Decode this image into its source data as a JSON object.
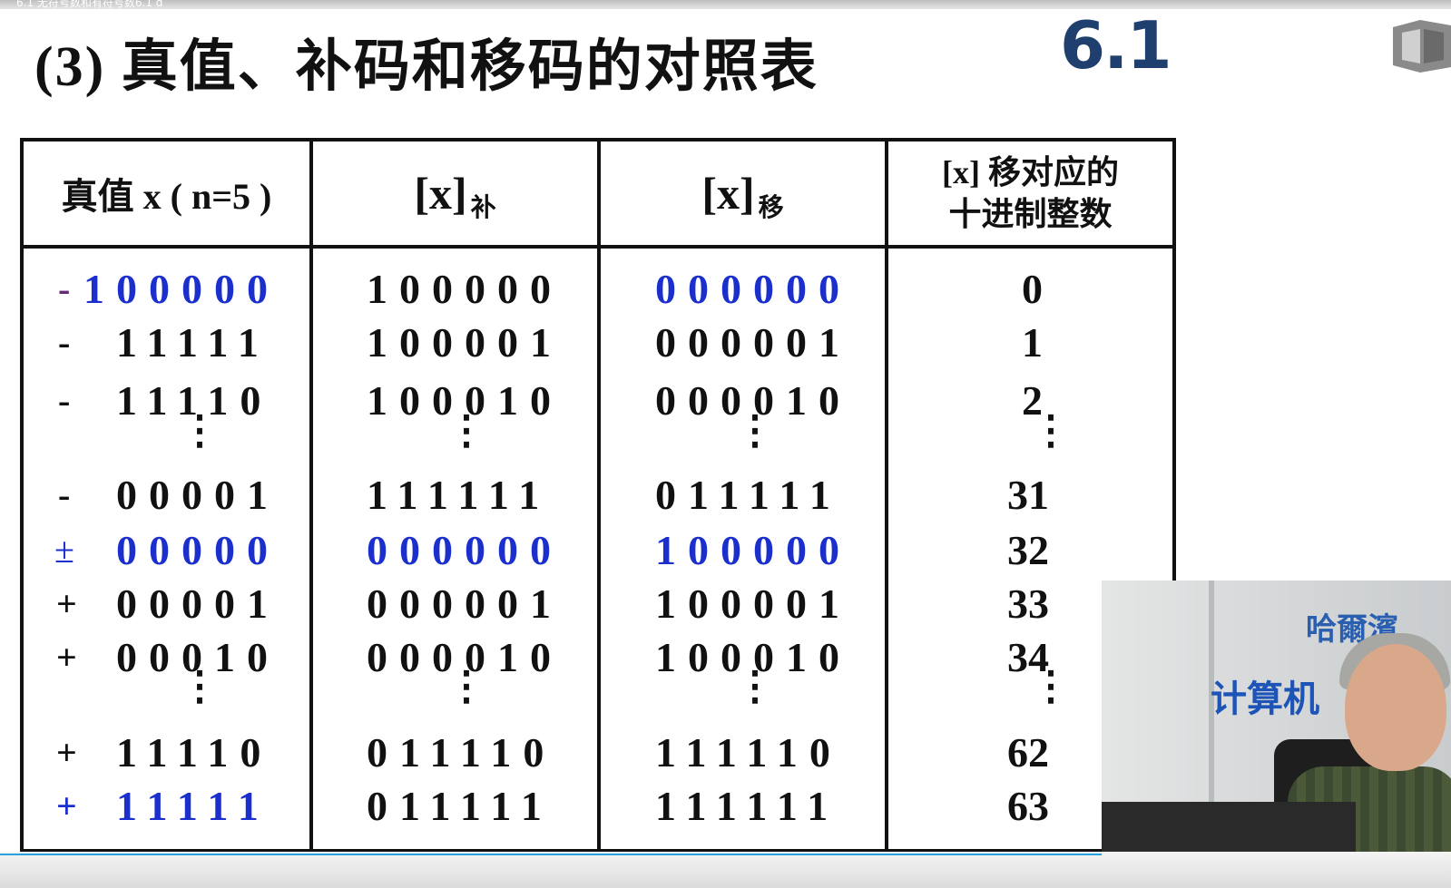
{
  "video_bar": {
    "title": "6.1 无符号数和有符号数6.1 d"
  },
  "slide": {
    "title": "(3) 真值、补码和移码的对照表",
    "section_number": "6.1"
  },
  "table": {
    "headers": {
      "col1": "真值 x ( n=5 )",
      "col2_main": "[x]",
      "col2_sub": "补",
      "col3_main": "[x]",
      "col3_sub": "移",
      "col4_line1": "[x] 移对应的",
      "col4_line2": "十进制整数"
    },
    "rows": [
      {
        "sign": "-",
        "true": "100000",
        "comp": "100000",
        "biased": "000000",
        "dec": "0"
      },
      {
        "sign": "-",
        "true": "11111",
        "comp": "100001",
        "biased": "000001",
        "dec": "1"
      },
      {
        "sign": "-",
        "true": "11110",
        "comp": "100010",
        "biased": "000010",
        "dec": "2"
      },
      {
        "sign": "-",
        "true": "00001",
        "comp": "111111",
        "biased": "011111",
        "dec": "31"
      },
      {
        "sign": "±",
        "true": "00000",
        "comp": "000000",
        "biased": "100000",
        "dec": "32"
      },
      {
        "sign": "+",
        "true": "00001",
        "comp": "000001",
        "biased": "100001",
        "dec": "33"
      },
      {
        "sign": "+",
        "true": "00010",
        "comp": "000010",
        "biased": "100010",
        "dec": "34"
      },
      {
        "sign": "+",
        "true": "11110",
        "comp": "011110",
        "biased": "111110",
        "dec": "62"
      },
      {
        "sign": "+",
        "true": "11111",
        "comp": "011111",
        "biased": "111111",
        "dec": "63"
      }
    ],
    "ellipsis": "⋮"
  },
  "video": {
    "sign_top": "哈爾濱",
    "sign_main": "计算机"
  },
  "colors": {
    "accent_blue": "#1a2fcc",
    "title_number": "#1f3f6e",
    "progress": "#27a3e0"
  }
}
